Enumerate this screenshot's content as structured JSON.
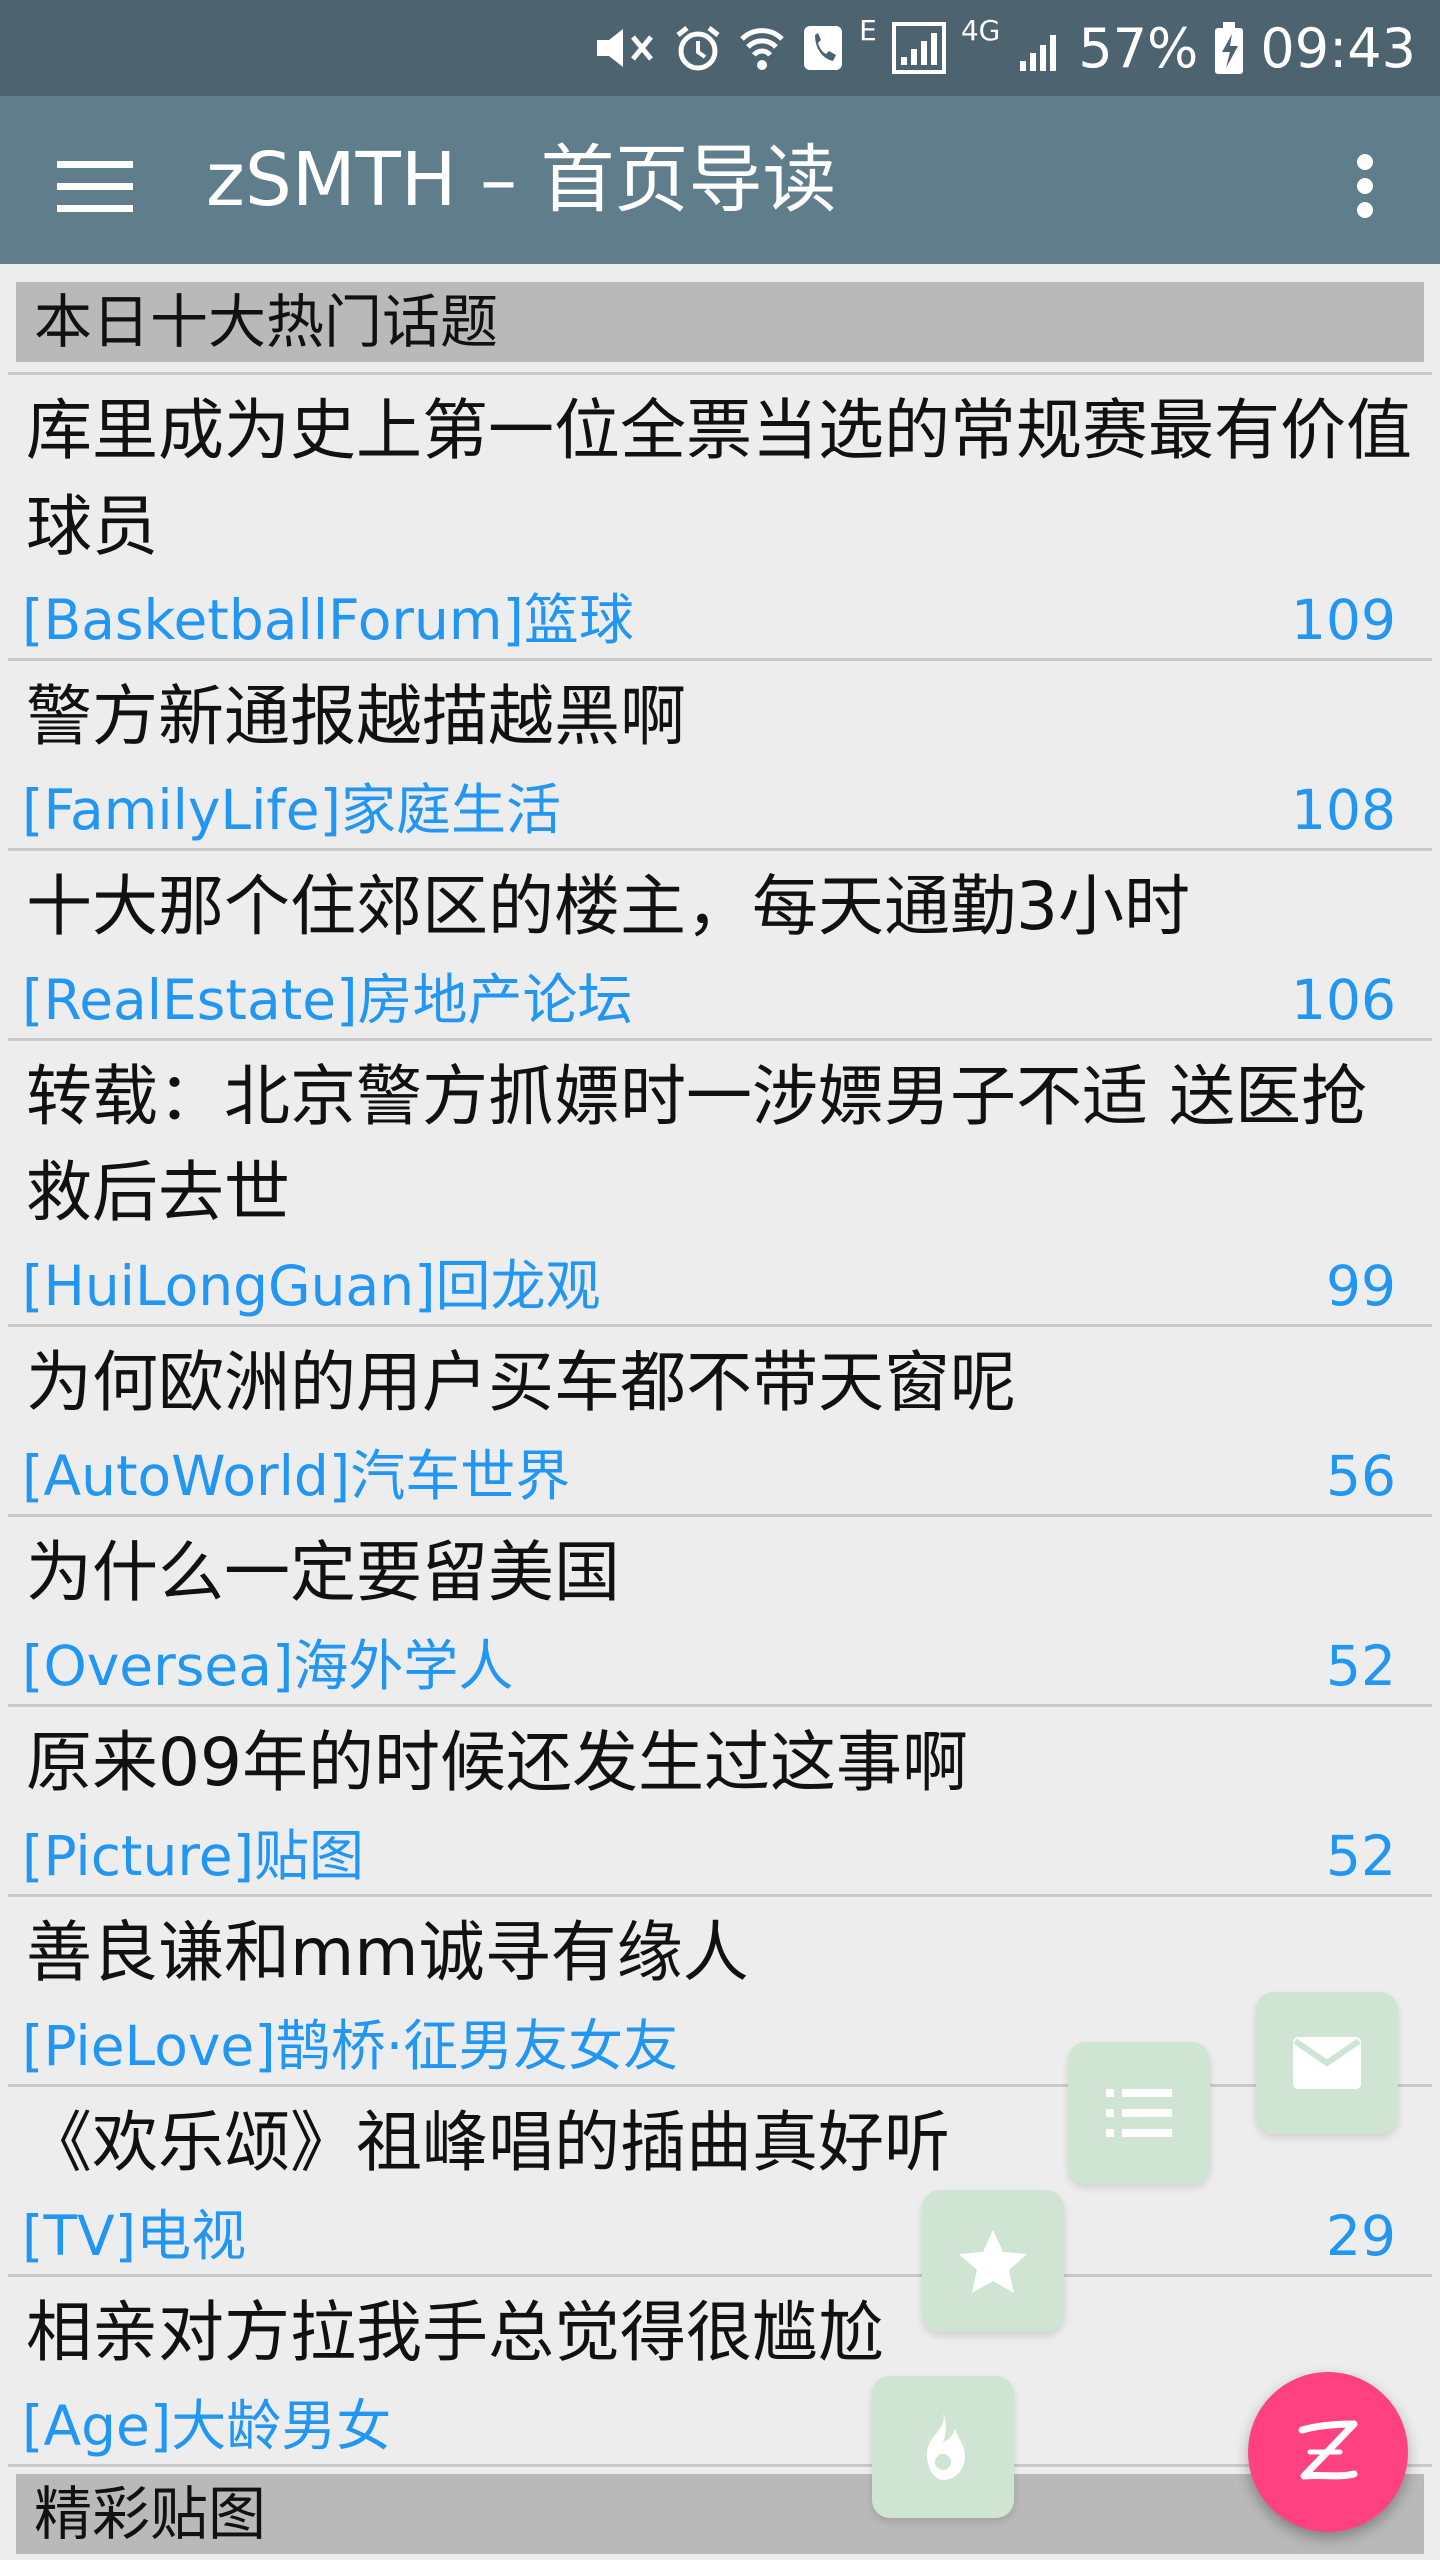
{
  "status_bar": {
    "battery": "57%",
    "time": "09:43",
    "network_4g": "4G",
    "network_e": "E"
  },
  "app_bar": {
    "title": "zSMTH – 首页导读"
  },
  "sections": [
    {
      "title": "本日十大热门话题"
    },
    {
      "title": "精彩贴图"
    }
  ],
  "topics": [
    {
      "title": "库里成为史上第一位全票当选的常规赛最有价值球员",
      "board": "[BasketballForum]篮球",
      "count": "109"
    },
    {
      "title": "警方新通报越描越黑啊",
      "board": "[FamilyLife]家庭生活",
      "count": "108"
    },
    {
      "title": "十大那个住郊区的楼主，每天通勤3小时",
      "board": "[RealEstate]房地产论坛",
      "count": "106"
    },
    {
      "title": "转载：北京警方抓嫖时一涉嫖男子不适 送医抢救后去世",
      "board": "[HuiLongGuan]回龙观",
      "count": "99"
    },
    {
      "title": "为何欧洲的用户买车都不带天窗呢",
      "board": "[AutoWorld]汽车世界",
      "count": "56"
    },
    {
      "title": "为什么一定要留美国",
      "board": "[Oversea]海外学人",
      "count": "52"
    },
    {
      "title": "原来09年的时候还发生过这事啊",
      "board": "[Picture]贴图",
      "count": "52"
    },
    {
      "title": "善良谦和mm诚寻有缘人",
      "board": "[PieLove]鹊桥·征男友女友",
      "count": ""
    },
    {
      "title": "《欢乐颂》祖峰唱的插曲真好听",
      "board": "[TV]电视",
      "count": "29"
    },
    {
      "title": "相亲对方拉我手总觉得很尴尬",
      "board": "[Age]大龄男女",
      "count": ""
    }
  ],
  "fab": {
    "main_icon": "z-logo-icon",
    "actions": [
      "mail-icon",
      "list-icon",
      "star-icon",
      "fire-icon"
    ],
    "main_color": "#ff4081",
    "mini_color": "#cfe4d3"
  },
  "colors": {
    "status_bar": "#4e6370",
    "app_bar": "#607d8b",
    "link": "#2196f3",
    "section_bg": "#b9b9b9"
  }
}
